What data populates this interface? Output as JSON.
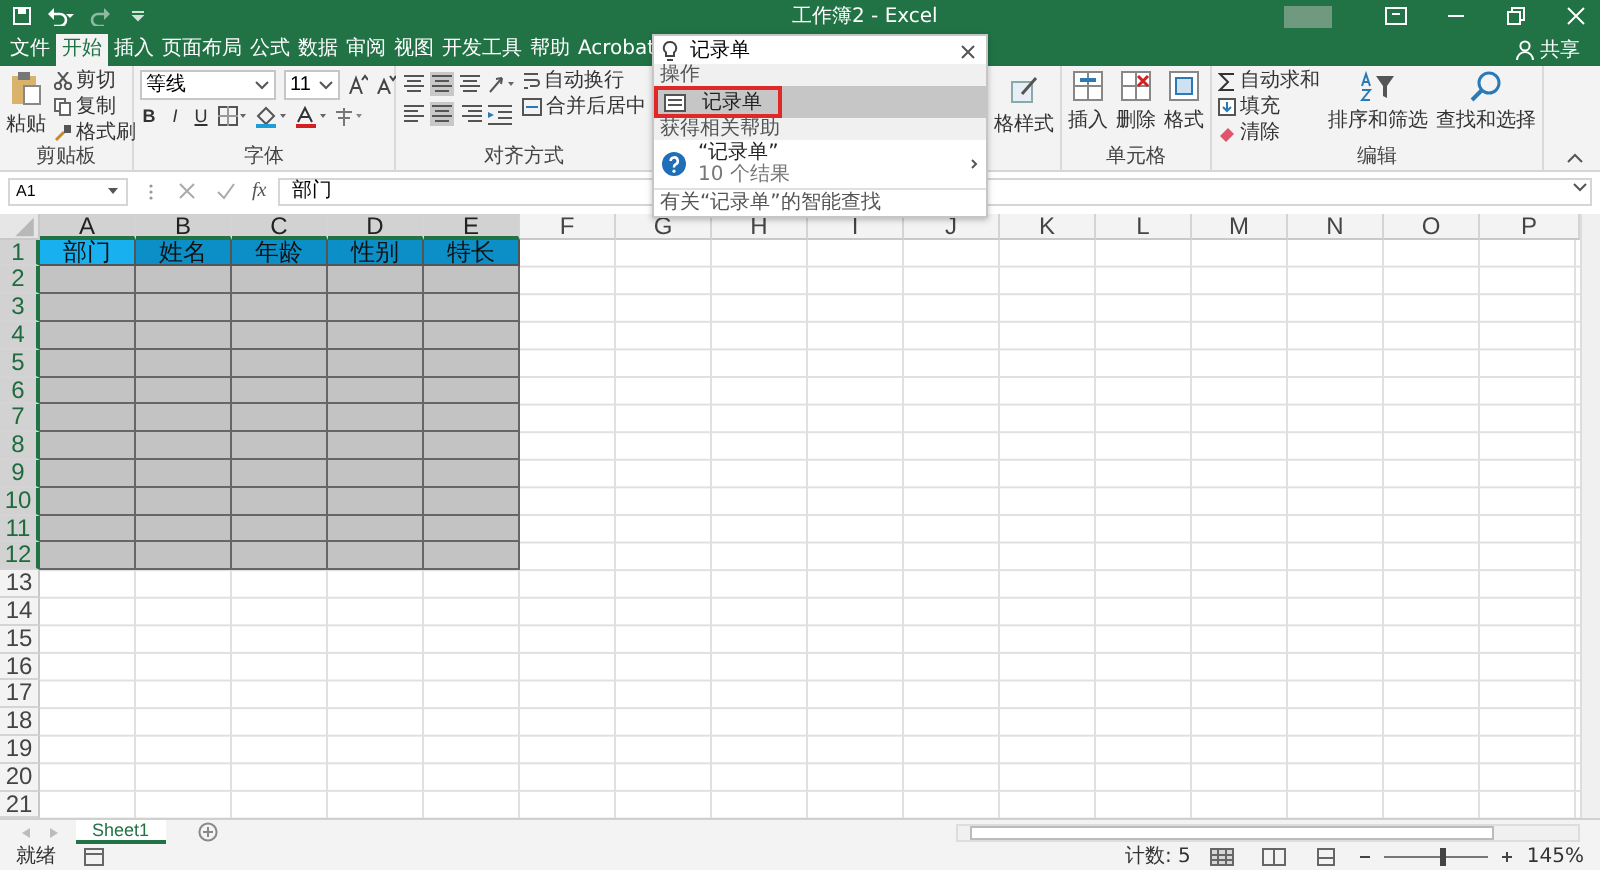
{
  "window": {
    "title": "工作簿2 - Excel"
  },
  "ribbon_tabs": [
    {
      "label": "文件",
      "selected": false
    },
    {
      "label": "开始",
      "selected": true
    },
    {
      "label": "插入",
      "selected": false
    },
    {
      "label": "页面布局",
      "selected": false
    },
    {
      "label": "公式",
      "selected": false
    },
    {
      "label": "数据",
      "selected": false
    },
    {
      "label": "审阅",
      "selected": false
    },
    {
      "label": "视图",
      "selected": false
    },
    {
      "label": "开发工具",
      "selected": false
    },
    {
      "label": "帮助",
      "selected": false
    },
    {
      "label": "Acrobat",
      "selected": false
    }
  ],
  "share": "共享",
  "clipboard": {
    "paste": "粘贴",
    "cut": "剪切",
    "copy": "复制",
    "format_painter": "格式刷",
    "label": "剪贴板"
  },
  "font": {
    "name": "等线",
    "size": "11",
    "bold": "B",
    "italic": "I",
    "underline": "U",
    "label": "字体"
  },
  "alignment": {
    "wrap": "自动换行",
    "merge": "合并后居中",
    "label": "对齐方式"
  },
  "styles_partial": "格样式",
  "cells": {
    "insert": "插入",
    "delete": "删除",
    "format": "格式",
    "label": "单元格"
  },
  "editing": {
    "autosum": "自动求和",
    "fill": "填充",
    "clear": "清除",
    "sort": "排序和筛选",
    "find": "查找和选择",
    "label": "编辑"
  },
  "search": {
    "query": "记录单",
    "actions_heading": "操作",
    "action": {
      "label": "记录单",
      "selected": true,
      "highlighted": true
    },
    "help_heading": "获得相关帮助",
    "help_item": {
      "title": "“记录单”",
      "subtitle": "10 个结果"
    },
    "footer": "有关“记录单”的智能查找"
  },
  "formula_bar": {
    "name_box": "A1",
    "function_button": "fx",
    "value": "部门"
  },
  "grid": {
    "columns": [
      {
        "label": "A",
        "selected": true
      },
      {
        "label": "B",
        "selected": true
      },
      {
        "label": "C",
        "selected": true
      },
      {
        "label": "D",
        "selected": true
      },
      {
        "label": "E",
        "selected": true
      },
      {
        "label": "F",
        "selected": false
      },
      {
        "label": "G",
        "selected": false
      },
      {
        "label": "H",
        "selected": false
      },
      {
        "label": "I",
        "selected": false
      },
      {
        "label": "J",
        "selected": false
      },
      {
        "label": "K",
        "selected": false
      },
      {
        "label": "L",
        "selected": false
      },
      {
        "label": "M",
        "selected": false
      },
      {
        "label": "N",
        "selected": false
      },
      {
        "label": "O",
        "selected": false
      },
      {
        "label": "P",
        "selected": false
      }
    ],
    "rows": [
      {
        "label": "1",
        "selected": true,
        "kind": "header",
        "cells": [
          {
            "text": "部门",
            "selected": true
          },
          {
            "text": "姓名",
            "selected": false
          },
          {
            "text": "年龄",
            "selected": false
          },
          {
            "text": "性别",
            "selected": false
          },
          {
            "text": "特长",
            "selected": false
          }
        ]
      },
      {
        "label": "2",
        "selected": true,
        "kind": "shaded"
      },
      {
        "label": "3",
        "selected": true,
        "kind": "shaded"
      },
      {
        "label": "4",
        "selected": true,
        "kind": "shaded"
      },
      {
        "label": "5",
        "selected": true,
        "kind": "shaded"
      },
      {
        "label": "6",
        "selected": true,
        "kind": "shaded"
      },
      {
        "label": "7",
        "selected": true,
        "kind": "shaded"
      },
      {
        "label": "8",
        "selected": true,
        "kind": "shaded"
      },
      {
        "label": "9",
        "selected": true,
        "kind": "shaded"
      },
      {
        "label": "10",
        "selected": true,
        "kind": "shaded"
      },
      {
        "label": "11",
        "selected": true,
        "kind": "shaded"
      },
      {
        "label": "12",
        "selected": true,
        "kind": "shaded"
      },
      {
        "label": "13",
        "selected": false,
        "kind": "plain"
      },
      {
        "label": "14",
        "selected": false,
        "kind": "plain"
      },
      {
        "label": "15",
        "selected": false,
        "kind": "plain"
      },
      {
        "label": "16",
        "selected": false,
        "kind": "plain"
      },
      {
        "label": "17",
        "selected": false,
        "kind": "plain"
      },
      {
        "label": "18",
        "selected": false,
        "kind": "plain"
      },
      {
        "label": "19",
        "selected": false,
        "kind": "plain"
      },
      {
        "label": "20",
        "selected": false,
        "kind": "plain"
      },
      {
        "label": "21",
        "selected": false,
        "kind": "plain"
      }
    ]
  },
  "sheet_tabs": [
    {
      "label": "Sheet1",
      "selected": true
    }
  ],
  "status_bar": {
    "state": "就绪",
    "count": "计数: 5",
    "zoom": {
      "level": 0.55
    },
    "zoom_label": "145%"
  }
}
